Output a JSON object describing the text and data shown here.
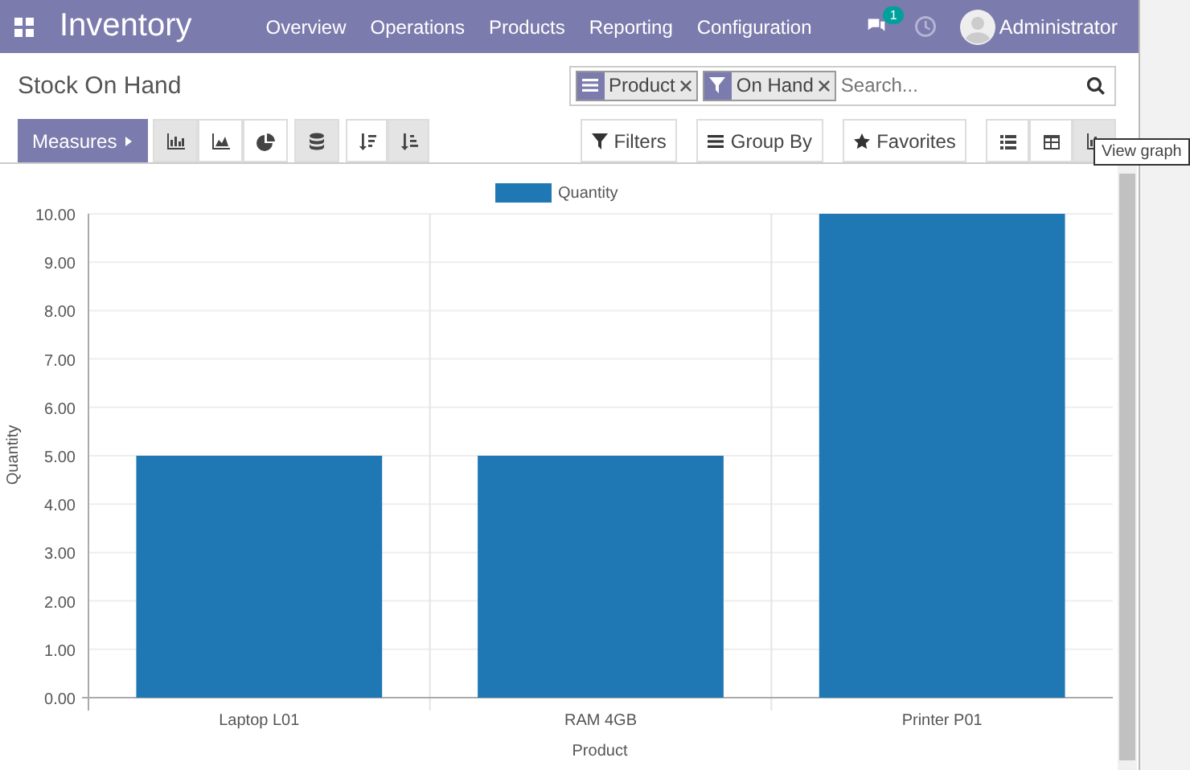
{
  "navbar": {
    "app": "Inventory",
    "menu": [
      "Overview",
      "Operations",
      "Products",
      "Reporting",
      "Configuration"
    ],
    "messages_badge": "1",
    "user": "Administrator"
  },
  "control_panel": {
    "title": "Stock On Hand",
    "measures": "Measures",
    "chart_types": [
      {
        "kind": "bar",
        "selected": true
      },
      {
        "kind": "line",
        "selected": false
      },
      {
        "kind": "pie",
        "selected": false
      }
    ],
    "stacked": {
      "selected": true
    },
    "sorts": [
      {
        "kind": "desc",
        "selected": false
      },
      {
        "kind": "asc",
        "selected": true
      }
    ],
    "facets": [
      {
        "kind": "group",
        "label": "Product"
      },
      {
        "kind": "filter",
        "label": "On Hand"
      }
    ],
    "search": {
      "placeholder": "Search..."
    },
    "filters": [
      {
        "kind": "filter",
        "label": "Filters"
      },
      {
        "kind": "group",
        "label": "Group By"
      },
      {
        "kind": "star",
        "label": "Favorites"
      }
    ],
    "views": [
      {
        "kind": "list",
        "selected": false
      },
      {
        "kind": "pivot",
        "selected": false
      },
      {
        "kind": "graph",
        "selected": true
      }
    ],
    "tooltip": "View graph"
  },
  "chart_data": {
    "type": "bar",
    "grid": true,
    "xlabel": "Product",
    "ylabel": "Quantity",
    "categories": [
      "Laptop L01",
      "RAM 4GB",
      "Printer P01"
    ],
    "series": [
      {
        "name": "Quantity",
        "color": "#1f77b4",
        "values": [
          5,
          5,
          10
        ]
      }
    ],
    "ylim": [
      0,
      10
    ],
    "yticks": [
      {
        "value": 0,
        "label": "0.00"
      },
      {
        "value": 1,
        "label": "1.00"
      },
      {
        "value": 2,
        "label": "2.00"
      },
      {
        "value": 3,
        "label": "3.00"
      },
      {
        "value": 4,
        "label": "4.00"
      },
      {
        "value": 5,
        "label": "5.00"
      },
      {
        "value": 6,
        "label": "6.00"
      },
      {
        "value": 7,
        "label": "7.00"
      },
      {
        "value": 8,
        "label": "8.00"
      },
      {
        "value": 9,
        "label": "9.00"
      },
      {
        "value": 10,
        "label": "10.00"
      }
    ]
  }
}
